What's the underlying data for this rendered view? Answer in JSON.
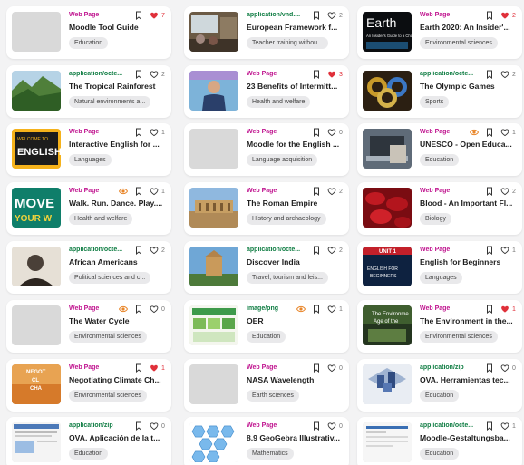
{
  "colors": {
    "web_type": "#c0148f",
    "app_type": "#0f7d43",
    "heart_liked": "#e0303a",
    "eye": "#e8862a"
  },
  "cards": [
    {
      "type": "Web Page",
      "kind": "web",
      "title": "Moodle Tool Guide",
      "tag": "Education",
      "likes": "7",
      "liked": true,
      "eye": false,
      "thumb": "placeholder"
    },
    {
      "type": "application/vnd....",
      "kind": "app",
      "title": "European Framework f...",
      "tag": "Teacher training withou...",
      "likes": "2",
      "liked": false,
      "eye": false,
      "thumb": "classroom"
    },
    {
      "type": "Web Page",
      "kind": "web",
      "title": "Earth 2020: An Insider'...",
      "tag": "Environmental sciences",
      "likes": "2",
      "liked": true,
      "eye": false,
      "thumb": "earth-book"
    },
    {
      "type": "application/octe...",
      "kind": "app",
      "title": "The Tropical Rainforest",
      "tag": "Natural environments a...",
      "likes": "2",
      "liked": false,
      "eye": false,
      "thumb": "rainforest"
    },
    {
      "type": "Web Page",
      "kind": "web",
      "title": "23 Benefits of Intermitt...",
      "tag": "Health and welfare",
      "likes": "3",
      "liked": true,
      "eye": false,
      "thumb": "presenter"
    },
    {
      "type": "application/octe...",
      "kind": "app",
      "title": "The Olympic Games",
      "tag": "Sports",
      "likes": "2",
      "liked": false,
      "eye": false,
      "thumb": "olympic"
    },
    {
      "type": "Web Page",
      "kind": "web",
      "title": "Interactive English for ...",
      "tag": "Languages",
      "likes": "1",
      "liked": false,
      "eye": false,
      "thumb": "english"
    },
    {
      "type": "Web Page",
      "kind": "web",
      "title": "Moodle for the English ...",
      "tag": "Language acquisition",
      "likes": "0",
      "liked": false,
      "eye": false,
      "thumb": "placeholder"
    },
    {
      "type": "Web Page",
      "kind": "web",
      "title": "UNESCO - Open Educa...",
      "tag": "Education",
      "likes": "1",
      "liked": false,
      "eye": true,
      "thumb": "laptop"
    },
    {
      "type": "Web Page",
      "kind": "web",
      "title": "Walk. Run. Dance. Play....",
      "tag": "Health and welfare",
      "likes": "1",
      "liked": false,
      "eye": true,
      "thumb": "move"
    },
    {
      "type": "Web Page",
      "kind": "web",
      "title": "The Roman Empire",
      "tag": "History and archaeology",
      "likes": "2",
      "liked": false,
      "eye": false,
      "thumb": "roman"
    },
    {
      "type": "Web Page",
      "kind": "web",
      "title": "Blood - An Important Fl...",
      "tag": "Biology",
      "likes": "2",
      "liked": false,
      "eye": false,
      "thumb": "blood"
    },
    {
      "type": "application/octe...",
      "kind": "app",
      "title": "African Americans",
      "tag": "Political sciences and c...",
      "likes": "2",
      "liked": false,
      "eye": false,
      "thumb": "portrait"
    },
    {
      "type": "application/octe...",
      "kind": "app",
      "title": "Discover India",
      "tag": "Travel, tourism and leis...",
      "likes": "2",
      "liked": false,
      "eye": false,
      "thumb": "india"
    },
    {
      "type": "Web Page",
      "kind": "web",
      "title": "English for Beginners",
      "tag": "Languages",
      "likes": "1",
      "liked": false,
      "eye": false,
      "thumb": "unit1"
    },
    {
      "type": "Web Page",
      "kind": "web",
      "title": "The Water Cycle",
      "tag": "Environmental sciences",
      "likes": "0",
      "liked": false,
      "eye": true,
      "thumb": "placeholder"
    },
    {
      "type": "image/png",
      "kind": "app",
      "title": "OER",
      "tag": "Education",
      "likes": "1",
      "liked": false,
      "eye": true,
      "thumb": "oer"
    },
    {
      "type": "Web Page",
      "kind": "web",
      "title": "The Environment in the...",
      "tag": "Environmental sciences",
      "likes": "1",
      "liked": true,
      "eye": false,
      "thumb": "environment"
    },
    {
      "type": "Web Page",
      "kind": "web",
      "title": "Negotiating Climate Ch...",
      "tag": "Environmental sciences",
      "likes": "1",
      "liked": true,
      "eye": false,
      "thumb": "climate"
    },
    {
      "type": "Web Page",
      "kind": "web",
      "title": "NASA Wavelength",
      "tag": "Earth sciences",
      "likes": "0",
      "liked": false,
      "eye": false,
      "thumb": "placeholder"
    },
    {
      "type": "application/zip",
      "kind": "app",
      "title": "OVA. Herramientas tec...",
      "tag": "Education",
      "likes": "0",
      "liked": false,
      "eye": false,
      "thumb": "city"
    },
    {
      "type": "application/zip",
      "kind": "app",
      "title": "OVA. Aplicación de la t...",
      "tag": "Education",
      "likes": "0",
      "liked": false,
      "eye": false,
      "thumb": "webpage"
    },
    {
      "type": "Web Page",
      "kind": "web",
      "title": "8.9 GeoGebra Illustrativ...",
      "tag": "Mathematics",
      "likes": "0",
      "liked": false,
      "eye": false,
      "thumb": "hexagons"
    },
    {
      "type": "application/octe...",
      "kind": "app",
      "title": "Moodle-Gestaltungsba...",
      "tag": "Education",
      "likes": "1",
      "liked": false,
      "eye": false,
      "thumb": "webpage2"
    }
  ],
  "thumb_text": {
    "earth": "Earth",
    "earth_sub": "An Insider's Guide to a Changing Planet",
    "english": "ENGLISH",
    "english_top": "WELCOME TO",
    "move": "MOVE",
    "move_sub": "YOUR W",
    "unit1": "UNIT 1",
    "unit1_sub": "ENGLISH FOR BEGINNERS",
    "oer": "OER",
    "climate": "NEGOT CL CHA",
    "environment": "The Environme Age of the"
  }
}
